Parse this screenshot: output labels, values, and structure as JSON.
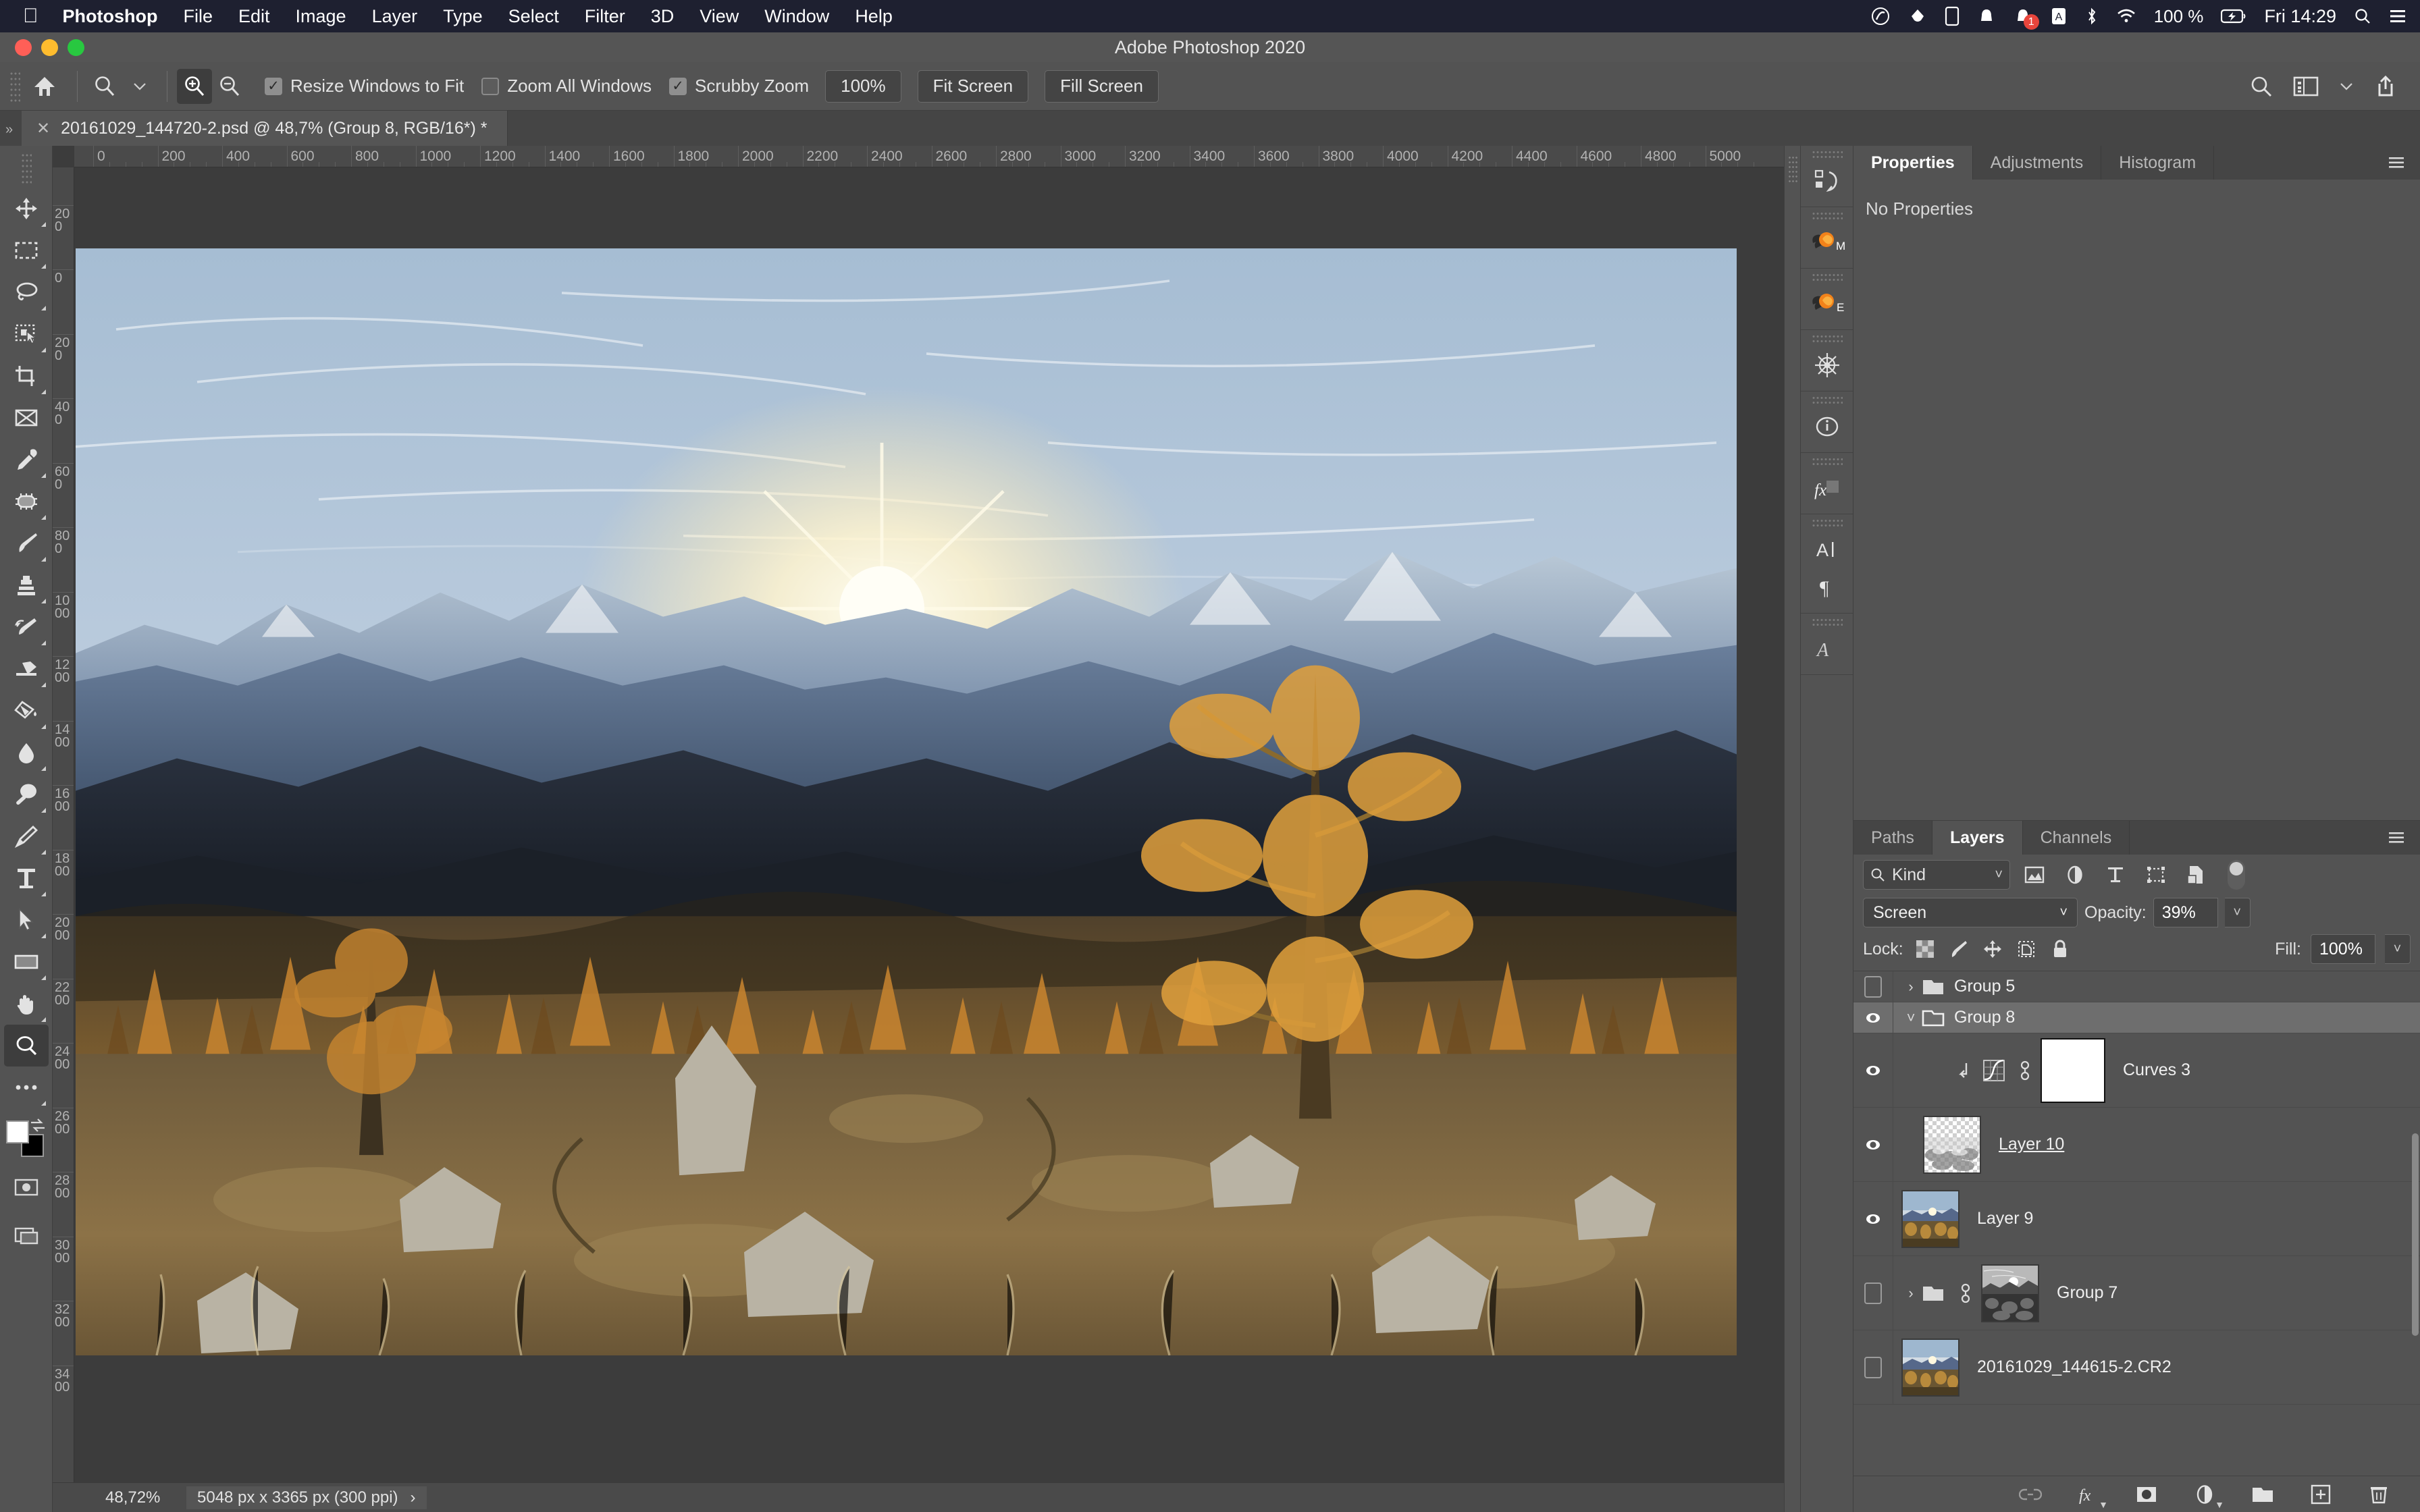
{
  "macmenu": {
    "apple_icon": "apple-icon",
    "items": [
      {
        "label": "Photoshop",
        "bold": true
      },
      {
        "label": "File"
      },
      {
        "label": "Edit"
      },
      {
        "label": "Image"
      },
      {
        "label": "Layer"
      },
      {
        "label": "Type"
      },
      {
        "label": "Select"
      },
      {
        "label": "Filter"
      },
      {
        "label": "3D"
      },
      {
        "label": "View"
      },
      {
        "label": "Window"
      },
      {
        "label": "Help"
      }
    ],
    "status": {
      "battery_percent": "100 %",
      "clock": "Fri 14:29",
      "notification_badge": "1",
      "icons": [
        "creative-cloud-icon",
        "dropbox-icon",
        "device-icon",
        "bell-icon",
        "notification-icon",
        "input-source-icon",
        "bluetooth-icon",
        "wifi-icon",
        "battery-icon",
        "spotlight-search-icon",
        "control-center-icon"
      ]
    }
  },
  "window": {
    "title": "Adobe Photoshop 2020"
  },
  "options_bar": {
    "home_icon": "home-icon",
    "tool_icon": "zoom-tool-icon",
    "tool_preset_chevron": "chevron-down-icon",
    "zoom_in_icon": "zoom-in-icon",
    "zoom_out_icon": "zoom-out-icon",
    "resize_windows_label": "Resize Windows to Fit",
    "resize_windows_checked": true,
    "zoom_all_label": "Zoom All Windows",
    "zoom_all_checked": false,
    "scrubby_label": "Scrubby Zoom",
    "scrubby_checked": true,
    "zoom_100_label": "100%",
    "fit_screen_label": "Fit Screen",
    "fill_screen_label": "Fill Screen",
    "search_icon": "search-icon",
    "workspace_icon": "workspace-switcher-icon",
    "workspace_chevron": "chevron-down-icon",
    "share_icon": "share-icon"
  },
  "document_tab": {
    "close_icon": "close-icon",
    "title": "20161029_144720-2.psd @ 48,7% (Group 8, RGB/16*) *"
  },
  "toolbar": {
    "tools": [
      {
        "name": "move-tool",
        "icon": "move-icon",
        "has_submenu": true
      },
      {
        "name": "rectangular-marquee-tool",
        "icon": "marquee-icon",
        "has_submenu": true
      },
      {
        "name": "lasso-tool",
        "icon": "lasso-icon",
        "has_submenu": true
      },
      {
        "name": "object-selection-tool",
        "icon": "quick-selection-icon",
        "has_submenu": true
      },
      {
        "name": "crop-tool",
        "icon": "crop-icon",
        "has_submenu": true
      },
      {
        "name": "frame-tool",
        "icon": "frame-icon",
        "has_submenu": false
      },
      {
        "name": "eyedropper-tool",
        "icon": "eyedropper-icon",
        "has_submenu": true
      },
      {
        "name": "spot-healing-brush-tool",
        "icon": "healing-brush-icon",
        "has_submenu": true
      },
      {
        "name": "brush-tool",
        "icon": "brush-icon",
        "has_submenu": true
      },
      {
        "name": "clone-stamp-tool",
        "icon": "clone-stamp-icon",
        "has_submenu": true
      },
      {
        "name": "history-brush-tool",
        "icon": "history-brush-icon",
        "has_submenu": true
      },
      {
        "name": "eraser-tool",
        "icon": "eraser-icon",
        "has_submenu": true
      },
      {
        "name": "gradient-tool",
        "icon": "paint-bucket-icon",
        "has_submenu": true
      },
      {
        "name": "blur-tool",
        "icon": "blur-drop-icon",
        "has_submenu": true
      },
      {
        "name": "dodge-tool",
        "icon": "dodge-icon",
        "has_submenu": true
      },
      {
        "name": "pen-tool",
        "icon": "pen-icon",
        "has_submenu": true
      },
      {
        "name": "type-tool",
        "icon": "type-icon",
        "has_submenu": true
      },
      {
        "name": "path-selection-tool",
        "icon": "path-selection-icon",
        "has_submenu": true
      },
      {
        "name": "rectangle-tool",
        "icon": "rectangle-icon",
        "has_submenu": true
      },
      {
        "name": "hand-tool",
        "icon": "hand-icon",
        "has_submenu": true
      },
      {
        "name": "zoom-tool",
        "icon": "zoom-icon",
        "has_submenu": false,
        "active": true
      },
      {
        "name": "edit-toolbar",
        "icon": "ellipsis-icon",
        "has_submenu": true
      }
    ],
    "foreground_color": "#ffffff",
    "background_color": "#000000",
    "swap_icon": "swap-colors-icon",
    "quick_mask_icon": "quick-mask-icon",
    "screen_mode_icon": "screen-mode-icon"
  },
  "rulers": {
    "unit": "px",
    "horizontal_labels": [
      "0",
      "200",
      "400",
      "600",
      "800",
      "1000",
      "1200",
      "1400",
      "1600",
      "1800",
      "2000",
      "2200",
      "2400",
      "2600",
      "2800",
      "3000",
      "3200",
      "3400",
      "3600",
      "3800",
      "4000",
      "4200",
      "4400",
      "4600",
      "4800",
      "5000"
    ],
    "vertical_labels": [
      "0",
      "200",
      "0",
      "200",
      "400",
      "600",
      "800",
      "1000",
      "1200",
      "1400",
      "1600",
      "1800",
      "2000",
      "2200",
      "2400",
      "2600",
      "2800",
      "3000",
      "3200",
      "3400"
    ]
  },
  "status_bar": {
    "zoom_level": "48,72%",
    "dimensions": "5048 px x 3365 px (300 ppi)",
    "expand_icon": "chevron-right-icon"
  },
  "icon_rail": {
    "groups": [
      {
        "icons": [
          {
            "name": "history-panel-icon",
            "label": ""
          }
        ]
      },
      {
        "icons": [
          {
            "name": "nik-color-efex-icon",
            "label": "M"
          }
        ]
      },
      {
        "icons": [
          {
            "name": "nik-hdr-efex-icon",
            "label": "E"
          }
        ]
      },
      {
        "icons": [
          {
            "name": "navigator-icon",
            "label": ""
          }
        ]
      },
      {
        "icons": [
          {
            "name": "info-panel-icon",
            "label": ""
          }
        ]
      },
      {
        "icons": [
          {
            "name": "styles-fx-icon",
            "label": ""
          }
        ]
      },
      {
        "icons": [
          {
            "name": "character-panel-icon",
            "label": ""
          },
          {
            "name": "paragraph-panel-icon",
            "label": ""
          }
        ]
      },
      {
        "icons": [
          {
            "name": "glyphs-panel-icon",
            "label": ""
          }
        ]
      }
    ]
  },
  "properties_panel": {
    "tabs": [
      {
        "label": "Properties",
        "active": true
      },
      {
        "label": "Adjustments",
        "active": false
      },
      {
        "label": "Histogram",
        "active": false
      }
    ],
    "menu_icon": "panel-menu-icon",
    "empty_message": "No Properties"
  },
  "layers_panel": {
    "tabs": [
      {
        "label": "Paths",
        "active": false
      },
      {
        "label": "Layers",
        "active": true
      },
      {
        "label": "Channels",
        "active": false
      }
    ],
    "menu_icon": "panel-menu-icon",
    "filter": {
      "search_icon": "search-icon",
      "kind_label": "Kind",
      "chevron": "chevron-down-icon",
      "type_filters": [
        "pixel-filter-icon",
        "adjustment-filter-icon",
        "type-filter-icon",
        "shape-filter-icon",
        "smart-object-filter-icon"
      ],
      "toggle": "filter-enable-toggle"
    },
    "blend_mode": "Screen",
    "blend_chevron": "chevron-down-icon",
    "opacity_label": "Opacity:",
    "opacity_value": "39%",
    "lock_label": "Lock:",
    "lock_icons": [
      "lock-transparency-icon",
      "lock-image-icon",
      "lock-position-icon",
      "lock-artboard-icon",
      "lock-all-icon"
    ],
    "fill_label": "Fill:",
    "fill_value": "100%",
    "layers": [
      {
        "name": "Group 5",
        "type": "group",
        "visible": false,
        "expanded": false,
        "selected": false,
        "thumb": "none",
        "indent": 0
      },
      {
        "name": "Group 8",
        "type": "group",
        "visible": true,
        "expanded": true,
        "selected": true,
        "thumb": "none",
        "indent": 0
      },
      {
        "name": "Curves 3",
        "type": "adjustment",
        "visible": true,
        "selected": false,
        "clipped": true,
        "linked": true,
        "mask": "white",
        "indent": 1
      },
      {
        "name": "Layer 10",
        "type": "pixel",
        "visible": true,
        "selected": false,
        "thumb": "checker",
        "underline": true,
        "indent": 1
      },
      {
        "name": "Layer 9",
        "type": "pixel",
        "visible": true,
        "selected": false,
        "thumb": "photo",
        "indent": 1
      },
      {
        "name": "Group 7",
        "type": "group",
        "visible": false,
        "expanded": false,
        "selected": false,
        "thumb": "bw-photo",
        "linked": true,
        "indent": 0
      },
      {
        "name": "20161029_144615-2.CR2",
        "type": "smart-object",
        "visible": false,
        "selected": false,
        "thumb": "photo",
        "indent": 0
      }
    ],
    "footer_icons": [
      "link-layers-icon",
      "add-layer-style-icon",
      "add-layer-mask-icon",
      "new-adjustment-layer-icon",
      "new-group-icon",
      "new-layer-icon",
      "delete-layer-icon"
    ]
  },
  "colors": {
    "app_bg": "#535353",
    "panel_bg": "#535353",
    "canvas_bg": "#3c3c3c",
    "menubar_bg": "#1e2030",
    "selection": "#6e6e6e",
    "accent_orange": "#f08a24",
    "badge_red": "#e8453c"
  }
}
